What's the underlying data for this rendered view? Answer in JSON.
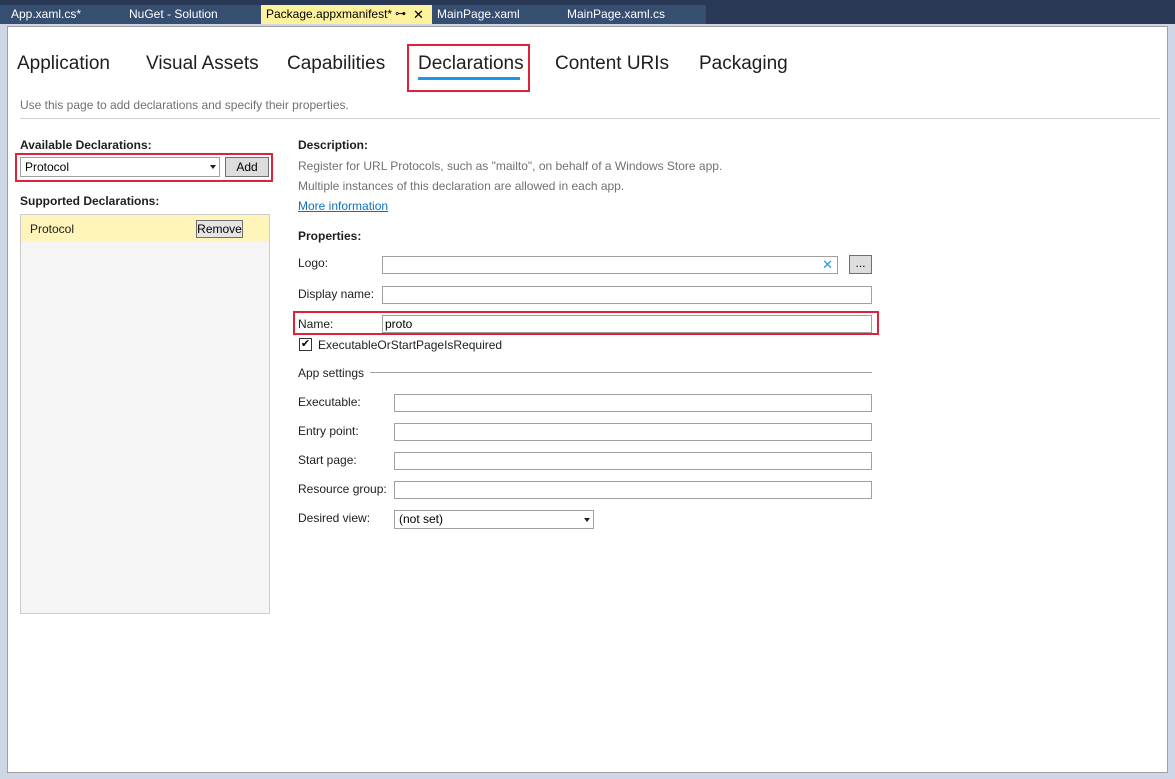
{
  "doc_tabs": [
    {
      "label": "App.xaml.cs*"
    },
    {
      "label": "NuGet - Solution"
    },
    {
      "label": "Package.appxmanifest*",
      "pin": "⊶",
      "close": "✕"
    },
    {
      "label": "MainPage.xaml"
    },
    {
      "label": "MainPage.xaml.cs"
    }
  ],
  "manifest_tabs": [
    {
      "label": "Application"
    },
    {
      "label": "Visual Assets"
    },
    {
      "label": "Capabilities"
    },
    {
      "label": "Declarations"
    },
    {
      "label": "Content URIs"
    },
    {
      "label": "Packaging"
    }
  ],
  "hint": "Use this page to add declarations and specify their properties.",
  "available": {
    "label": "Available Declarations:",
    "selected": "Protocol",
    "add_label": "Add"
  },
  "supported": {
    "label": "Supported Declarations:",
    "items": [
      {
        "name": "Protocol",
        "remove_label": "Remove"
      }
    ]
  },
  "description": {
    "label": "Description:",
    "line1": "Register for URL Protocols, such as \"mailto\", on behalf of a Windows Store app.",
    "line2": "Multiple instances of this declaration are allowed in each app.",
    "more_info": "More information"
  },
  "properties": {
    "label": "Properties:",
    "logo_label": "Logo:",
    "logo_value": "",
    "clear": "✕",
    "browse": "...",
    "display_name_label": "Display name:",
    "display_name_value": "",
    "name_label": "Name:",
    "name_value": "proto",
    "check_label": "ExecutableOrStartPageIsRequired",
    "check_mark": "✔",
    "checked": true
  },
  "app_settings": {
    "label": "App settings",
    "executable_label": "Executable:",
    "entry_point_label": "Entry point:",
    "start_page_label": "Start page:",
    "resource_group_label": "Resource group:",
    "desired_view_label": "Desired view:",
    "desired_view_value": "(not set)"
  },
  "colors": {
    "chrome": "#293955",
    "active_tab": "#fff29d",
    "accent": "#1c97ea",
    "highlight": "#e0213c",
    "selected_row": "#fff4b9"
  }
}
